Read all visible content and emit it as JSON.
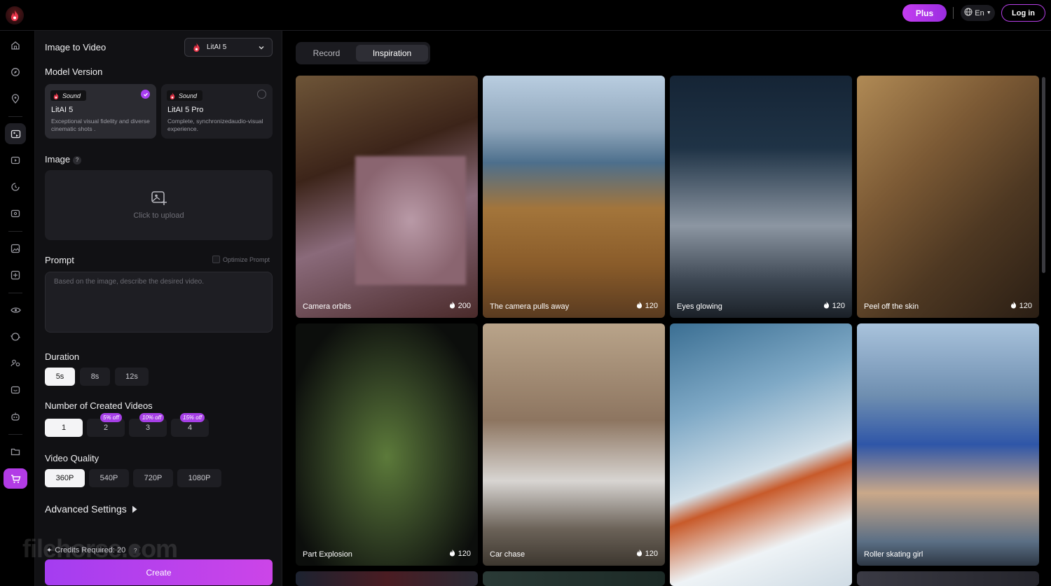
{
  "header": {
    "plus_label": "Plus",
    "lang_label": "En",
    "login_label": "Log in"
  },
  "panel": {
    "title": "Image to Video",
    "model_select_value": "LitAI 5",
    "model_version_label": "Model Version",
    "models": [
      {
        "badge": "Sound",
        "name": "LitAI 5",
        "desc": "Exceptional visual fidelity and diverse cinematic shots .",
        "selected": true
      },
      {
        "badge": "Sound",
        "name": "LitAI 5 Pro",
        "desc": "Complete, synchronizedaudio-visual experience.",
        "selected": false
      }
    ],
    "image_label": "Image",
    "help_mark": "?",
    "upload_label": "Click to upload",
    "prompt_label": "Prompt",
    "optimize_label": "Optimize Prompt",
    "prompt_placeholder": "Based on the image, describe the desired video.",
    "duration_label": "Duration",
    "durations": [
      "5s",
      "8s",
      "12s"
    ],
    "count_label": "Number of Created Videos",
    "counts": [
      "1",
      "2",
      "3",
      "4"
    ],
    "count_discounts": [
      "5% off",
      "10% off",
      "15% off"
    ],
    "quality_label": "Video Quality",
    "qualities": [
      "360P",
      "540P",
      "720P",
      "1080P"
    ],
    "advanced_label": "Advanced Settings",
    "credits_label": "Credits Required: 20",
    "create_label": "Create",
    "watermark": "filehorse.com"
  },
  "tabs": {
    "record": "Record",
    "inspiration": "Inspiration"
  },
  "gallery": [
    {
      "caption": "Camera orbits",
      "count": "200"
    },
    {
      "caption": "The camera pulls away",
      "count": "120"
    },
    {
      "caption": "Eyes glowing",
      "count": "120"
    },
    {
      "caption": "Peel off the skin",
      "count": "120"
    },
    {
      "caption": "Part Explosion",
      "count": "120"
    },
    {
      "caption": "Car chase",
      "count": "120"
    },
    {
      "caption": "",
      "count": ""
    },
    {
      "caption": "Roller skating girl",
      "count": ""
    }
  ],
  "colors": {
    "accent": "#a93ff0",
    "panel_bg": "#111114",
    "page_bg": "#000000"
  }
}
